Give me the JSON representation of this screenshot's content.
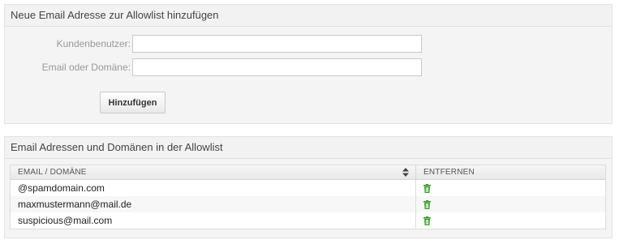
{
  "add_panel": {
    "title": "Neue Email Adresse zur Allowlist hinzufügen",
    "customer_user_label": "Kundenbenutzer:",
    "customer_user_value": "",
    "email_domain_label": "Email oder Domäne:",
    "email_domain_value": "",
    "submit_label": "Hinzufügen"
  },
  "list_panel": {
    "title": "Email Adressen und Domänen in der Allowlist",
    "columns": {
      "email": "EMAIL / DOMÄNE",
      "remove": "ENTFERNEN"
    },
    "rows": [
      {
        "email": "@spamdomain.com",
        "remove_icon": "trash-icon"
      },
      {
        "email": "maxmustermann@mail.de",
        "remove_icon": "trash-icon"
      },
      {
        "email": "suspicious@mail.com",
        "remove_icon": "trash-icon"
      }
    ],
    "colors": {
      "trash_icon": "#3a9a2a"
    }
  }
}
